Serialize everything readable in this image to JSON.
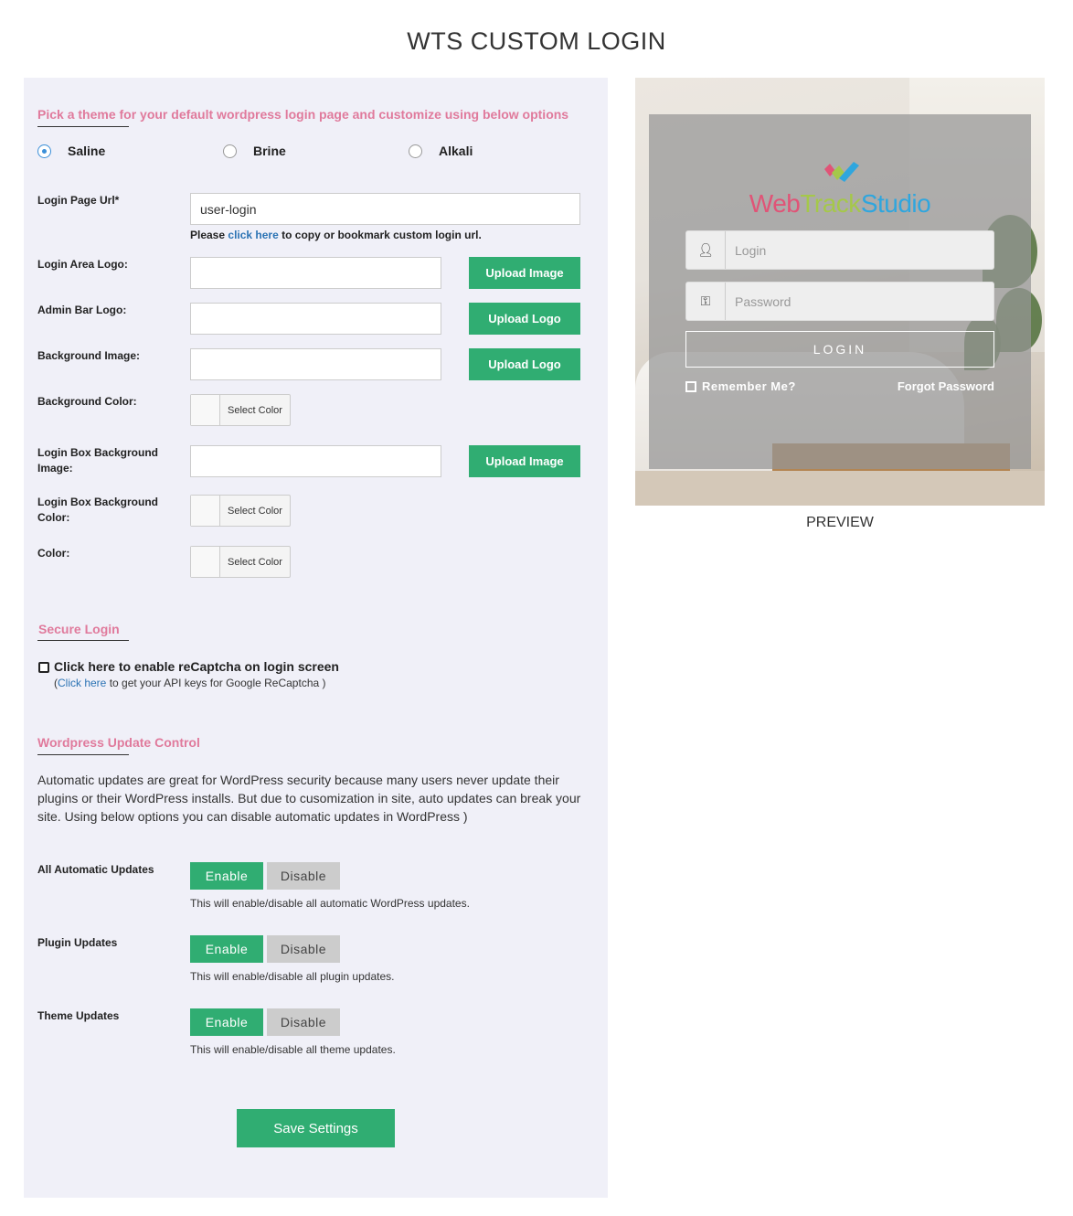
{
  "page_title": "WTS CUSTOM LOGIN",
  "theme_section": {
    "heading": "Pick a theme for your default wordpress login page and customize using below options",
    "themes": [
      "Saline",
      "Brine",
      "Alkali"
    ],
    "selected": "Saline"
  },
  "fields": {
    "login_url": {
      "label": "Login Page Url*",
      "value": "user-login"
    },
    "login_url_hint": {
      "prefix": "Please",
      "link": "click here",
      "suffix": "to copy or bookmark custom login url."
    },
    "login_area_logo": {
      "label": "Login Area Logo:",
      "value": "",
      "button": "Upload Image"
    },
    "admin_bar_logo": {
      "label": "Admin Bar Logo:",
      "value": "",
      "button": "Upload Logo"
    },
    "background_image": {
      "label": "Background Image:",
      "value": "",
      "button": "Upload Logo"
    },
    "background_color": {
      "label": "Background Color:",
      "button": "Select Color"
    },
    "login_box_bg_image": {
      "label": "Login Box Background Image:",
      "value": "",
      "button": "Upload Image"
    },
    "login_box_bg_color": {
      "label": "Login Box Background Color:",
      "button": "Select Color"
    },
    "color": {
      "label": "Color:",
      "button": "Select Color"
    }
  },
  "secure_login": {
    "heading": "Secure Login",
    "checkbox_label": "Click here to enable reCaptcha on login screen",
    "hint_open": "(",
    "hint_link": "Click here",
    "hint_rest": "to get your API keys for Google ReCaptcha )",
    "checked": false
  },
  "update_control": {
    "heading": "Wordpress Update Control",
    "description": "Automatic updates are great for WordPress security because many users never update their plugins or their WordPress installs. But due to cusomization in site, auto updates can break your site. Using below options you can disable automatic updates in WordPress )",
    "rows": [
      {
        "label": "All Automatic Updates",
        "enable": "Enable",
        "disable": "Disable",
        "note": "This will enable/disable all automatic WordPress updates."
      },
      {
        "label": "Plugin Updates",
        "enable": "Enable",
        "disable": "Disable",
        "note": "This will enable/disable all plugin updates."
      },
      {
        "label": "Theme Updates",
        "enable": "Enable",
        "disable": "Disable",
        "note": "This will enable/disable all theme updates."
      }
    ]
  },
  "save_button": "Save Settings",
  "preview": {
    "logo": {
      "part1": "Web",
      "part2": "Track",
      "part3": "Studio"
    },
    "login_placeholder": "Login",
    "password_placeholder": "Password",
    "login_button": "LOGIN",
    "remember_me": "Remember Me?",
    "forgot_password": "Forgot Password",
    "label": "PREVIEW"
  },
  "colors": {
    "accent_green": "#30ad72",
    "heading_pink": "#e07a9c",
    "panel_bg": "#f0f0f8",
    "link_blue": "#2b73b4"
  }
}
